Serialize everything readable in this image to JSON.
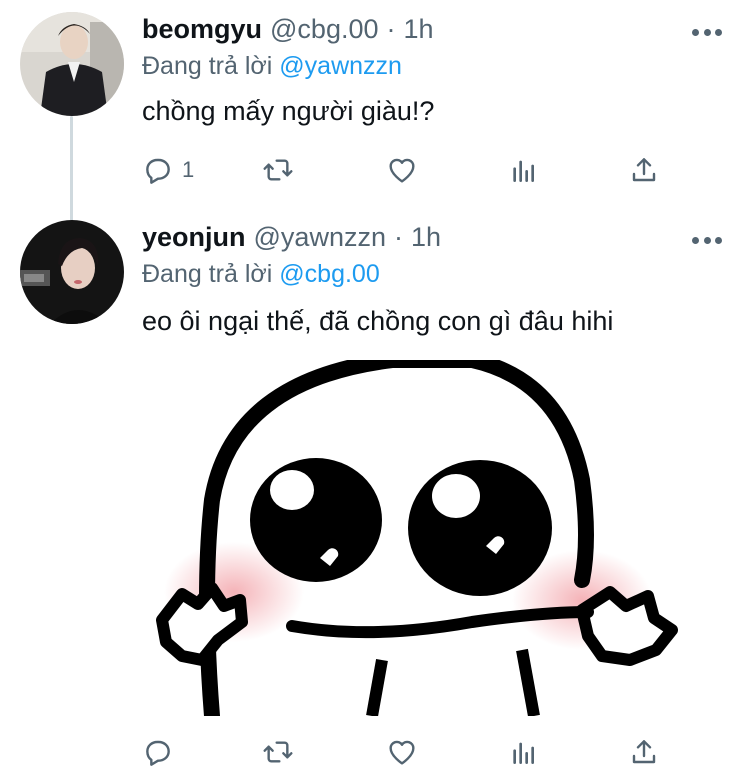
{
  "tweets": [
    {
      "name": "beomgyu",
      "handle": "@cbg.00",
      "dot": "·",
      "time": "1h",
      "replying_prefix": "Đang trả lời",
      "replying_to": "@yawnzzn",
      "text": "chồng mấy người giàu!?",
      "reply_count": "1"
    },
    {
      "name": "yeonjun",
      "handle": "@yawnzzn",
      "dot": "·",
      "time": "1h",
      "replying_prefix": "Đang trả lời",
      "replying_to": "@cbg.00",
      "text": "eo ôi ngại thế, đã chồng con gì đâu hihi",
      "reply_count": ""
    }
  ],
  "icons": {
    "reply": "reply-icon",
    "retweet": "retweet-icon",
    "like": "heart-icon",
    "analytics": "analytics-icon",
    "share": "share-icon",
    "more": "more-icon"
  },
  "colors": {
    "text": "#0f1419",
    "secondary": "#536471",
    "mention": "#1d9bf0",
    "thread_line": "#cfd9de"
  }
}
